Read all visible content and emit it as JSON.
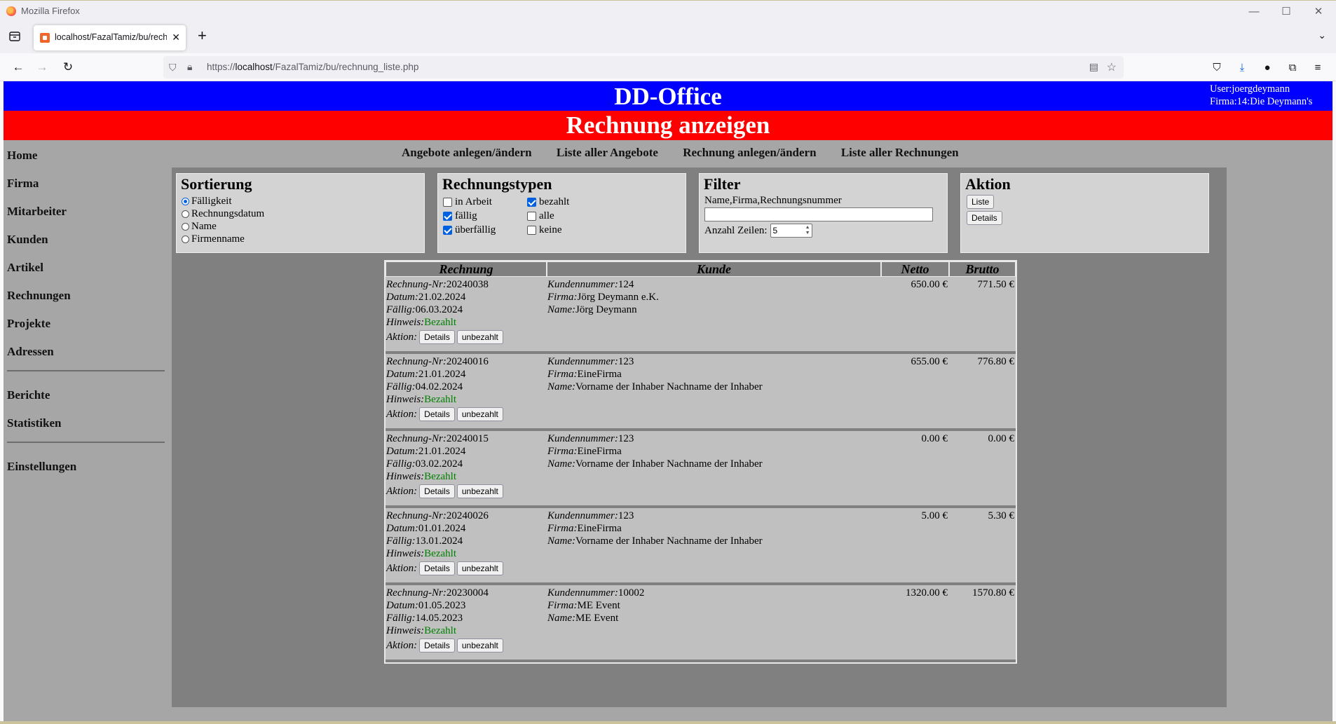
{
  "browser": {
    "window_title": "Mozilla Firefox",
    "tab_title": "localhost/FazalTamiz/bu/rechnu",
    "url_prefix": "https://",
    "url_host": "localhost",
    "url_path": "/FazalTamiz/bu/rechnung_liste.php"
  },
  "header": {
    "brand": "DD-Office",
    "user_line": "User:joergdeymann",
    "firma_line": "Firma:14:Die Deymann's",
    "page_title": "Rechnung anzeigen"
  },
  "sidebar": {
    "items_top": [
      "Home",
      "Firma",
      "Mitarbeiter",
      "Kunden",
      "Artikel",
      "Rechnungen",
      "Projekte",
      "Adressen"
    ],
    "items_mid": [
      "Berichte",
      "Statistiken"
    ],
    "items_bottom": [
      "Einstellungen"
    ]
  },
  "topmenu": [
    "Angebote anlegen/ändern",
    "Liste aller Angebote",
    "Rechnung anlegen/ändern",
    "Liste aller Rechnungen"
  ],
  "sortierung": {
    "title": "Sortierung",
    "options": [
      "Fälligkeit",
      "Rechnungsdatum",
      "Name",
      "Firmenname"
    ],
    "selected": "Fälligkeit"
  },
  "rechnungstypen": {
    "title": "Rechnungstypen",
    "options": [
      {
        "label": "in Arbeit",
        "checked": false
      },
      {
        "label": "bezahlt",
        "checked": true
      },
      {
        "label": "fällig",
        "checked": true
      },
      {
        "label": "alle",
        "checked": false
      },
      {
        "label": "überfällig",
        "checked": true
      },
      {
        "label": "keine",
        "checked": false
      }
    ]
  },
  "filter": {
    "title": "Filter",
    "field_label": "Name,Firma,Rechnungsnummer",
    "field_value": "",
    "rows_label": "Anzahl Zeilen:",
    "rows_value": "5"
  },
  "aktion": {
    "title": "Aktion",
    "btn_liste": "Liste",
    "btn_details": "Details"
  },
  "table": {
    "headers": [
      "Rechnung",
      "Kunde",
      "Netto",
      "Brutto"
    ],
    "labels": {
      "nr": "Rechnung-Nr:",
      "datum": "Datum:",
      "faellig": "Fällig:",
      "hinweis": "Hinweis:",
      "aktion": "Aktion:",
      "kundennummer": "Kundennummer:",
      "firma": "Firma:",
      "name": "Name:",
      "btn_details": "Details",
      "btn_unbezahlt": "unbezahlt"
    },
    "rows": [
      {
        "nr": "20240038",
        "datum": "21.02.2024",
        "faellig": "06.03.2024",
        "hinweis": "Bezahlt",
        "kundennummer": "124",
        "firma": "Jörg Deymann e.K.",
        "name": "Jörg Deymann",
        "netto": "650.00 €",
        "brutto": "771.50 €"
      },
      {
        "nr": "20240016",
        "datum": "21.01.2024",
        "faellig": "04.02.2024",
        "hinweis": "Bezahlt",
        "kundennummer": "123",
        "firma": "EineFirma",
        "name": "Vorname der Inhaber Nachname der Inhaber",
        "netto": "655.00 €",
        "brutto": "776.80 €"
      },
      {
        "nr": "20240015",
        "datum": "21.01.2024",
        "faellig": "03.02.2024",
        "hinweis": "Bezahlt",
        "kundennummer": "123",
        "firma": "EineFirma",
        "name": "Vorname der Inhaber Nachname der Inhaber",
        "netto": "0.00 €",
        "brutto": "0.00 €"
      },
      {
        "nr": "20240026",
        "datum": "01.01.2024",
        "faellig": "13.01.2024",
        "hinweis": "Bezahlt",
        "kundennummer": "123",
        "firma": "EineFirma",
        "name": "Vorname der Inhaber Nachname der Inhaber",
        "netto": "5.00 €",
        "brutto": "5.30 €"
      },
      {
        "nr": "20230004",
        "datum": "01.05.2023",
        "faellig": "14.05.2023",
        "hinweis": "Bezahlt",
        "kundennummer": "10002",
        "firma": "ME Event",
        "name": "ME Event",
        "netto": "1320.00 €",
        "brutto": "1570.80 €"
      }
    ]
  },
  "colors": {
    "banner_blue": "#0000ff",
    "banner_red": "#ff0000",
    "status_green": "#008000",
    "page_bg": "#a6a6a6",
    "panel_bg": "#d3d3d3"
  }
}
